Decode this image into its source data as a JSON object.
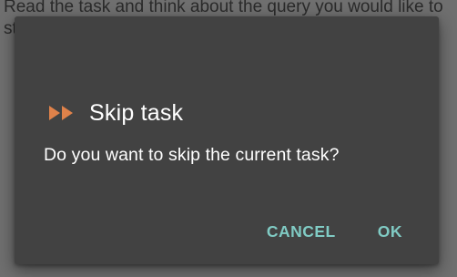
{
  "background": {
    "instruction_text": "Read the task and think about the query you would like to st"
  },
  "dialog": {
    "title": "Skip task",
    "icon": "fast-forward-icon",
    "message": "Do you want to skip the current task?",
    "cancel_label": "CANCEL",
    "ok_label": "OK"
  },
  "colors": {
    "dialog_bg": "#424242",
    "icon": "#e0824a",
    "accent": "#80cbc4",
    "text": "#ffffff"
  }
}
